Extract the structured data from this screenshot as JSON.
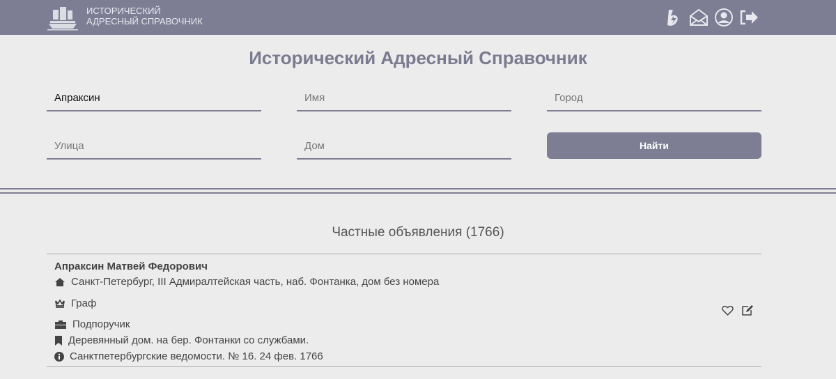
{
  "header": {
    "brand_line1": "Исторический",
    "brand_line2": "Адресный справочник"
  },
  "page_title": "Исторический Адресный Справочник",
  "form": {
    "surname_value": "Апраксин",
    "name_placeholder": "Имя",
    "city_placeholder": "Город",
    "street_placeholder": "Улица",
    "house_placeholder": "Дом",
    "search_label": "Найти"
  },
  "section_title": "Частные объявления (1766)",
  "record": {
    "name": "Апраксин Матвей Федорович",
    "address": "Санкт-Петербург, III Адмиралтейская часть, наб. Фонтанка, дом без номера",
    "title": "Граф",
    "rank": "Подпоручик",
    "note": "Деревянный дом. на бер. Фонтанки со службами.",
    "source": "Санктпетербургские ведомости. № 16. 24 фев. 1766"
  }
}
